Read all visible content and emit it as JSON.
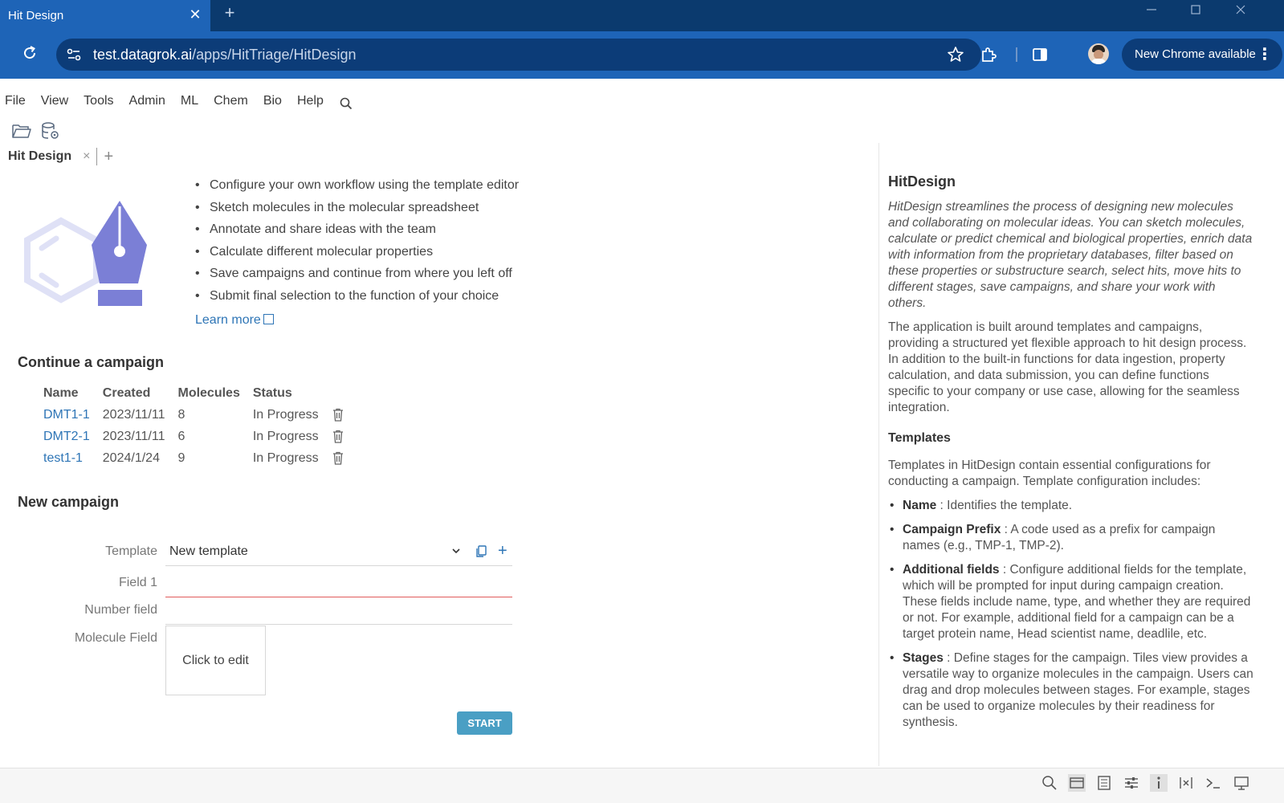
{
  "browser": {
    "tab_title": "Hit Design",
    "tab_close": "✕",
    "new_tab": "+",
    "url_host": "test.datagrok.ai",
    "url_path": "/apps/HitTriage/HitDesign",
    "update_label": "New Chrome available"
  },
  "menu": {
    "items": [
      "File",
      "View",
      "Tools",
      "Admin",
      "ML",
      "Chem",
      "Bio",
      "Help"
    ]
  },
  "view_tab": {
    "label": "Hit Design",
    "close": "×",
    "add": "+"
  },
  "features": [
    "Configure your own workflow using the template editor",
    "Sketch molecules in the molecular spreadsheet",
    "Annotate and share ideas with the team",
    "Calculate different molecular properties",
    "Save campaigns and continue from where you left off",
    "Submit final selection to the function of your choice"
  ],
  "learn_more": "Learn more",
  "continue_section": {
    "title": "Continue a campaign",
    "columns": [
      "Name",
      "Created",
      "Molecules",
      "Status"
    ],
    "rows": [
      {
        "name": "DMT1-1",
        "created": "2023/11/11",
        "molecules": "8",
        "status": "In Progress"
      },
      {
        "name": "DMT2-1",
        "created": "2023/11/11",
        "molecules": "6",
        "status": "In Progress"
      },
      {
        "name": "test1-1",
        "created": "2024/1/24",
        "molecules": "9",
        "status": "In Progress"
      }
    ]
  },
  "new_campaign": {
    "title": "New campaign",
    "template_label": "Template",
    "template_value": "New template",
    "field1_label": "Field 1",
    "field1_value": "",
    "number_label": "Number field",
    "number_value": "",
    "molecule_label": "Molecule Field",
    "molecule_placeholder": "Click to edit",
    "start_label": "START"
  },
  "panel": {
    "title": "HitDesign",
    "intro": "HitDesign streamlines the process of designing new molecules and collaborating on molecular ideas. You can sketch molecules, calculate or predict chemical and biological properties, enrich data with information from the proprietary databases, filter based on these properties or substructure search, select hits, move hits to different stages, save campaigns, and share your work with others.",
    "body": "The application is built around templates and campaigns, providing a structured yet flexible approach to hit design process. In addition to the built-in functions for data ingestion, property calculation, and data submission, you can define functions specific to your company or use case, allowing for the seamless integration.",
    "templates_title": "Templates",
    "templates_intro": "Templates in HitDesign contain essential configurations for conducting a campaign. Template configuration includes:",
    "items": [
      {
        "term": "Name",
        "desc": " : Identifies the template."
      },
      {
        "term": "Campaign Prefix",
        "desc": " : A code used as a prefix for campaign names (e.g., TMP-1, TMP-2)."
      },
      {
        "term": "Additional fields",
        "desc": " : Configure additional fields for the template, which will be prompted for input during campaign creation. These fields include name, type, and whether they are required or not. For example, additional field for a campaign can be a target protein name, Head scientist name, deadlile, etc."
      },
      {
        "term": "Stages",
        "desc": " : Define stages for the campaign. Tiles view provides a versatile way to organize molecules in the campaign. Users can drag and drop molecules between stages. For example, stages can be used to organize molecules by their readiness for synthesis."
      }
    ]
  },
  "colors": {
    "tab_bar": "#0b3a6e",
    "toolbar": "#1e64b7",
    "link": "#2e75b6",
    "start_button": "#4a9fc4",
    "logo_purple": "#7b7fd6"
  }
}
